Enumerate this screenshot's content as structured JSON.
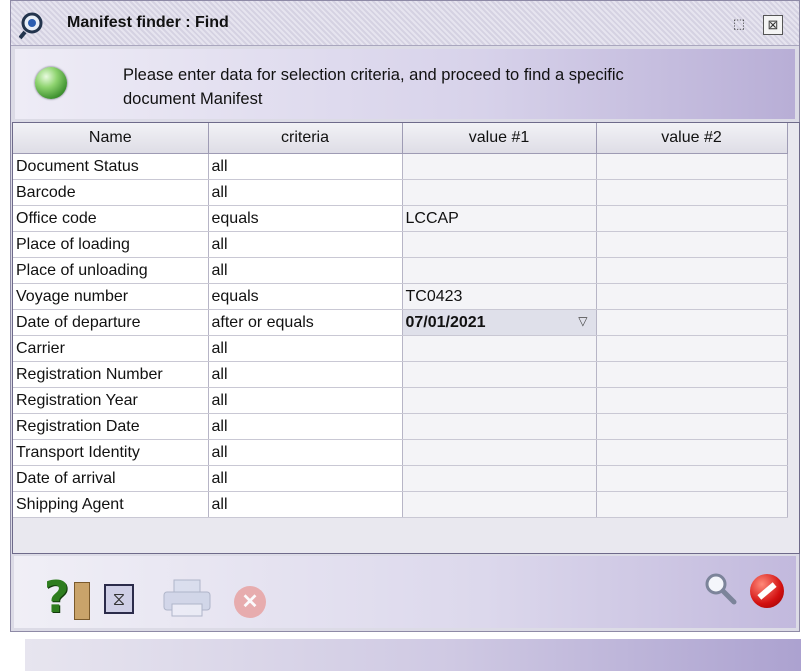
{
  "window": {
    "title": "Manifest finder : Find"
  },
  "header": {
    "message_line1": "Please enter data for selection criteria, and proceed to find a specific",
    "message_line2": "document Manifest"
  },
  "grid": {
    "columns": [
      "Name",
      "criteria",
      "value #1",
      "value #2"
    ],
    "rows": [
      {
        "name": "Document Status",
        "criteria": "all",
        "value1": "",
        "value2": ""
      },
      {
        "name": "Barcode",
        "criteria": "all",
        "value1": "",
        "value2": ""
      },
      {
        "name": "Office code",
        "criteria": "equals",
        "value1": "LCCAP",
        "value2": ""
      },
      {
        "name": "Place of loading",
        "criteria": "all",
        "value1": "",
        "value2": ""
      },
      {
        "name": "Place of unloading",
        "criteria": "all",
        "value1": "",
        "value2": ""
      },
      {
        "name": "Voyage number",
        "criteria": "equals",
        "value1": "TC0423",
        "value2": ""
      },
      {
        "name": "Date of departure",
        "criteria": "after or equals",
        "value1": "07/01/2021",
        "value2": ""
      },
      {
        "name": "Carrier",
        "criteria": "all",
        "value1": "",
        "value2": ""
      },
      {
        "name": "Registration Number",
        "criteria": "all",
        "value1": "",
        "value2": ""
      },
      {
        "name": "Registration Year",
        "criteria": "all",
        "value1": "",
        "value2": ""
      },
      {
        "name": "Registration Date",
        "criteria": "all",
        "value1": "",
        "value2": ""
      },
      {
        "name": "Transport Identity",
        "criteria": "all",
        "value1": "",
        "value2": ""
      },
      {
        "name": "Date of arrival",
        "criteria": "all",
        "value1": "",
        "value2": ""
      },
      {
        "name": "Shipping Agent",
        "criteria": "all",
        "value1": "",
        "value2": ""
      }
    ]
  },
  "toolbar": {
    "icons": [
      "help-icon",
      "clear-filter-icon",
      "print-icon",
      "cancel-icon",
      "search-icon",
      "stop-icon"
    ]
  },
  "colors": {
    "status_orb": "#3c8f2e",
    "date_cell": "#dfe0ea",
    "stop": "#d31010"
  }
}
